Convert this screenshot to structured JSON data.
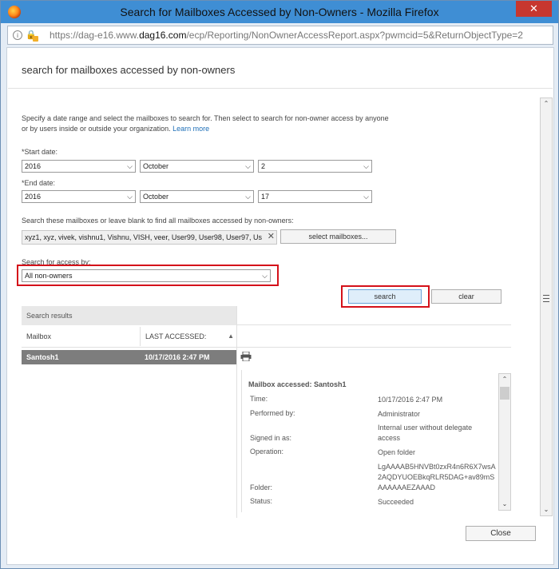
{
  "window": {
    "title": "Search for Mailboxes Accessed by Non-Owners - Mozilla Firefox",
    "close_glyph": "✕"
  },
  "urlbar": {
    "prefix": "https://dag-e16.www.",
    "domain": "dag16.com",
    "suffix": "/ecp/Reporting/NonOwnerAccessReport.aspx?pwmcid=5&ReturnObjectType=2"
  },
  "page": {
    "heading": "search for mailboxes accessed by non-owners",
    "intro": "Specify a date range and select the mailboxes to search for. Then select to search for non-owner access by anyone or by users inside or outside your organization.",
    "learn_more": "Learn more"
  },
  "start_date": {
    "label": "*Start date:",
    "year": "2016",
    "month": "October",
    "day": "2"
  },
  "end_date": {
    "label": "*End date:",
    "year": "2016",
    "month": "October",
    "day": "17"
  },
  "mailboxes": {
    "label": "Search these mailboxes or leave blank to find all mailboxes accessed by non-owners:",
    "tokens": "xyz1, xyz, vivek, vishnu1, Vishnu, VISH, veer, User99, User98, User97, Us",
    "select_button": "select mailboxes..."
  },
  "access": {
    "label": "Search for access by:",
    "value": "All non-owners"
  },
  "actions": {
    "search": "search",
    "clear": "clear"
  },
  "results": {
    "header": "Search results",
    "columns": [
      "Mailbox",
      "LAST ACCESSED:"
    ],
    "rows": [
      {
        "mailbox": "Santosh1",
        "last_accessed": "10/17/2016 2:47 PM"
      }
    ]
  },
  "details": {
    "title": "Mailbox accessed: Santosh1",
    "fields": {
      "time_label": "Time:",
      "time": "10/17/2016 2:47 PM",
      "performed_by_label": "Performed by:",
      "performed_by": "Administrator",
      "signed_in_label": "Signed in as:",
      "signed_in": "Internal user without delegate access",
      "operation_label": "Operation:",
      "operation": "Open folder",
      "folder_label": "Folder:",
      "folder": "LgAAAAB5HNVBt0zxR4n6R6X7wsA2AQDYUOEBkqRLR5DAG+av89mSAAAAAAEZAAAD",
      "status_label": "Status:",
      "status": "Succeeded"
    }
  },
  "footer": {
    "close": "Close"
  },
  "colors": {
    "titlebar": "#3f8ed4",
    "highlight_border": "#d4111a",
    "selected_row": "#7d7d7d",
    "link": "#1e6fb8"
  }
}
